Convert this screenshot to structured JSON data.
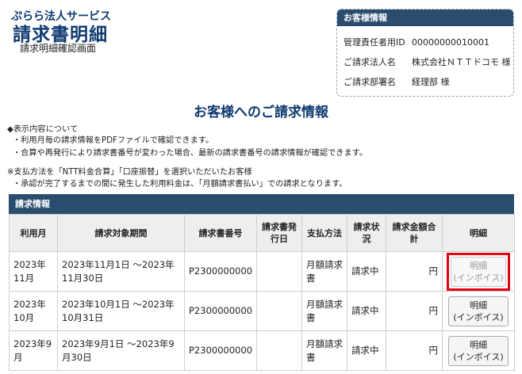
{
  "header": {
    "brand_top": "ぷらら法人サービス",
    "brand_main": "請求書明細",
    "brand_sub": "請求明細確認画面"
  },
  "customer": {
    "title": "お客様情報",
    "rows": [
      {
        "label": "管理責任者用ID",
        "value": "00000000010001"
      },
      {
        "label": "ご請求法人名",
        "value": "株式会社ＮＴＴドコモ 様"
      },
      {
        "label": "ご請求部署名",
        "value": "経理部 様"
      }
    ]
  },
  "page_title": "お客様へのご請求情報",
  "notes": {
    "l1": "◆表示内容について",
    "l2": "・利用月毎の請求情報をPDFファイルで確認できます。",
    "l3": "・合算や再発行により請求書番号が変わった場合、最新の請求書番号の請求情報が確認できます。",
    "l4": "※支払方法を「NTT料金合算」「口座振替」を選択いただいたお客様",
    "l5": "・承認が完了するまでの間に発生した利用料金は、「月額請求書払い」での請求となります。"
  },
  "table": {
    "title": "請求情報",
    "headers": [
      "利用月",
      "請求対象期間",
      "請求書番号",
      "請求書発行日",
      "支払方法",
      "請求状況",
      "請求金額合計",
      "明細"
    ],
    "rows": [
      {
        "month": "2023年11月",
        "period": "2023年11月1日 ～2023年11月30日",
        "invoice_no": "P2300000000",
        "issue_date": "",
        "payment": "月額請求書",
        "status": "請求中",
        "amount": "円",
        "button": "明細\n(インボイス)",
        "button_disabled": true,
        "highlighted": true
      },
      {
        "month": "2023年10月",
        "period": "2023年10月1日 ～2023年10月31日",
        "invoice_no": "P2300000000",
        "issue_date": "",
        "payment": "月額請求書",
        "status": "請求中",
        "amount": "円",
        "button": "明細\n(インボイス)",
        "button_disabled": false,
        "highlighted": false
      },
      {
        "month": "2023年9月",
        "period": "2023年9月1日 ～2023年9月30日",
        "invoice_no": "P2300000000",
        "issue_date": "",
        "payment": "月額請求書",
        "status": "請求中",
        "amount": "円",
        "button": "明細\n(インボイス)",
        "button_disabled": false,
        "highlighted": false
      }
    ]
  },
  "colors": {
    "brand": "#0e3a70",
    "header_bar": "#2a4d6e",
    "highlight": "#e50012"
  }
}
